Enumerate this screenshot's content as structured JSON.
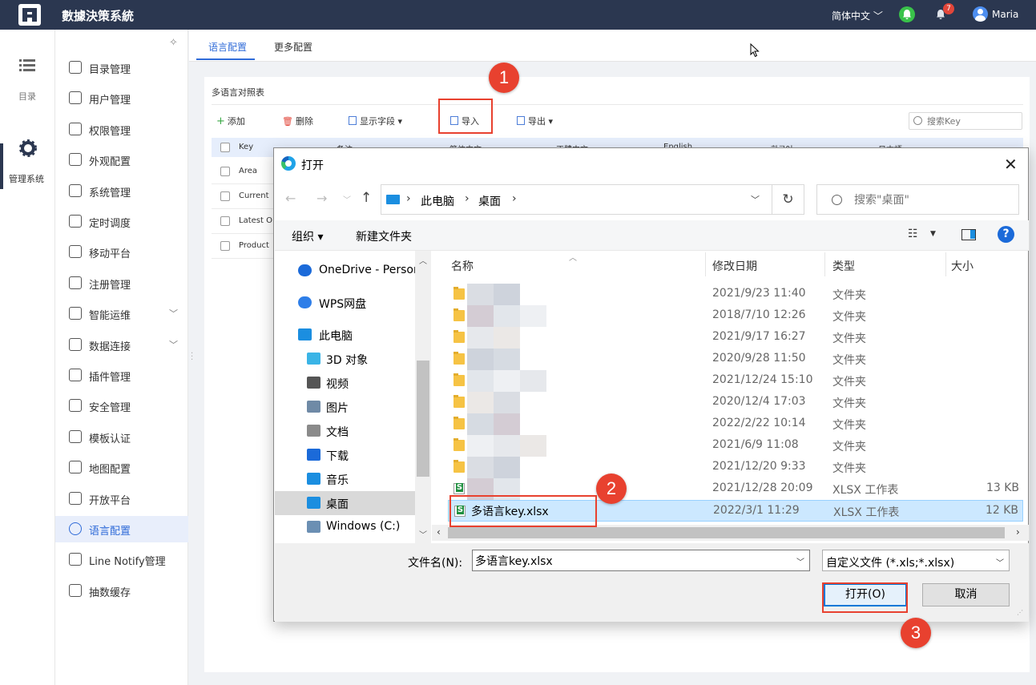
{
  "app": {
    "title": "數據決策系統",
    "language": "简体中文 ﹀",
    "notification_count": "7",
    "username": "Maria"
  },
  "rail": {
    "catalog_label": "目录",
    "system_label": "管理系统"
  },
  "sidebar": {
    "items": [
      {
        "label": "目录管理",
        "icon": "catalog-icon"
      },
      {
        "label": "用户管理",
        "icon": "user-icon"
      },
      {
        "label": "权限管理",
        "icon": "permission-icon"
      },
      {
        "label": "外观配置",
        "icon": "appearance-icon"
      },
      {
        "label": "系统管理",
        "icon": "system-icon"
      },
      {
        "label": "定时调度",
        "icon": "clock-icon"
      },
      {
        "label": "移动平台",
        "icon": "mobile-icon"
      },
      {
        "label": "注册管理",
        "icon": "register-icon"
      },
      {
        "label": "智能运维",
        "icon": "ops-icon",
        "expandable": true
      },
      {
        "label": "数据连接",
        "icon": "link-icon",
        "expandable": true
      },
      {
        "label": "插件管理",
        "icon": "plugin-icon"
      },
      {
        "label": "安全管理",
        "icon": "shield-icon"
      },
      {
        "label": "模板认证",
        "icon": "template-icon"
      },
      {
        "label": "地图配置",
        "icon": "map-icon"
      },
      {
        "label": "开放平台",
        "icon": "open-platform-icon"
      },
      {
        "label": "语言配置",
        "icon": "globe-icon",
        "active": true
      },
      {
        "label": "Line Notify管理",
        "icon": "line-icon"
      },
      {
        "label": "抽数缓存",
        "icon": "cache-icon"
      }
    ]
  },
  "tabs": {
    "language": "语言配置",
    "more": "更多配置"
  },
  "panel": {
    "title": "多语言对照表",
    "toolbar": {
      "add": "添加",
      "delete": "删除",
      "fields": "显示字段",
      "import": "导入",
      "export": "导出",
      "search_placeholder": "搜索Key"
    },
    "table": {
      "columns": [
        "Key",
        "备注",
        "简体中文",
        "正體中文",
        "English",
        "한국어",
        "日本語"
      ],
      "rows": [
        "Area",
        "Current",
        "Latest O",
        "Product"
      ]
    }
  },
  "markers": {
    "m1": "1",
    "m2": "2",
    "m3": "3"
  },
  "dialog": {
    "title": "打开",
    "breadcrumb": [
      "此电脑",
      "桌面"
    ],
    "search_placeholder": "搜索\"桌面\"",
    "organize": "组织 ▾",
    "new_folder": "新建文件夹",
    "help": "?",
    "nav": [
      {
        "label": "OneDrive - Personal",
        "icon": "onedrive-icon"
      },
      {
        "label": "WPS网盘",
        "icon": "wps-cloud-icon"
      },
      {
        "label": "此电脑",
        "icon": "pc-icon"
      },
      {
        "label": "3D 对象",
        "icon": "3d-objects-icon"
      },
      {
        "label": "视频",
        "icon": "video-icon"
      },
      {
        "label": "图片",
        "icon": "picture-icon"
      },
      {
        "label": "文档",
        "icon": "document-icon"
      },
      {
        "label": "下载",
        "icon": "download-icon"
      },
      {
        "label": "音乐",
        "icon": "music-icon"
      },
      {
        "label": "桌面",
        "icon": "desktop-icon"
      },
      {
        "label": "Windows (C:)",
        "icon": "drive-icon"
      }
    ],
    "columns": {
      "name": "名称",
      "modified": "修改日期",
      "type": "类型",
      "size": "大小"
    },
    "files": [
      {
        "name": "",
        "date": "2021/9/23 11:40",
        "type": "文件夹",
        "size": "",
        "kind": "folder"
      },
      {
        "name": "",
        "date": "2018/7/10 12:26",
        "type": "文件夹",
        "size": "",
        "kind": "folder"
      },
      {
        "name": "",
        "date": "2021/9/17 16:27",
        "type": "文件夹",
        "size": "",
        "kind": "folder"
      },
      {
        "name": "",
        "date": "2020/9/28 11:50",
        "type": "文件夹",
        "size": "",
        "kind": "folder"
      },
      {
        "name": "",
        "date": "2021/12/24 15:10",
        "type": "文件夹",
        "size": "",
        "kind": "folder"
      },
      {
        "name": "",
        "date": "2020/12/4 17:03",
        "type": "文件夹",
        "size": "",
        "kind": "folder"
      },
      {
        "name": "",
        "date": "2022/2/22 10:14",
        "type": "文件夹",
        "size": "",
        "kind": "folder"
      },
      {
        "name": "",
        "date": "2021/6/9 11:08",
        "type": "文件夹",
        "size": "",
        "kind": "folder"
      },
      {
        "name": "",
        "date": "2021/12/20 9:33",
        "type": "文件夹",
        "size": "",
        "kind": "folder"
      },
      {
        "name": "",
        "date": "2021/12/28 20:09",
        "type": "XLSX 工作表",
        "size": "13 KB",
        "kind": "xlsx"
      },
      {
        "name": "多语言key.xlsx",
        "date": "2022/3/1 11:29",
        "type": "XLSX 工作表",
        "size": "12 KB",
        "kind": "xlsx",
        "selected": true
      }
    ],
    "filename_label": "文件名(N):",
    "filename_value": "多语言key.xlsx",
    "filetype": "自定义文件 (*.xls;*.xlsx)",
    "open_button": "打开(O)",
    "cancel_button": "取消"
  }
}
